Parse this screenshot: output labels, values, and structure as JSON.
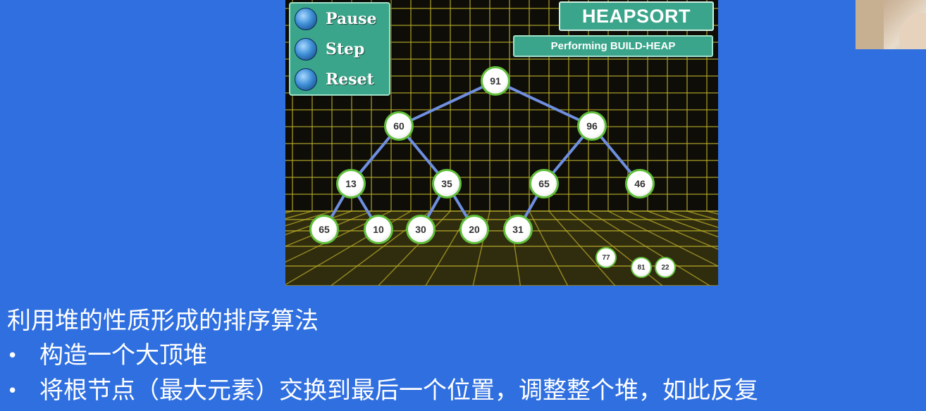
{
  "controls": {
    "pause_label": "Pause",
    "step_label": "Step",
    "reset_label": "Reset"
  },
  "title": "HEAPSORT",
  "status": "Performing BUILD-HEAP",
  "heap_nodes": [
    "91",
    "60",
    "96",
    "13",
    "35",
    "65",
    "46",
    "65",
    "10",
    "30",
    "20",
    "31"
  ],
  "sorted_nodes": [
    "77",
    "81",
    "22"
  ],
  "text": {
    "heading": "利用堆的性质形成的排序算法",
    "bullet_symbol": "•",
    "bullets": [
      "构造一个大顶堆",
      "将根节点（最大元素）交换到最后一个位置，调整整个堆，如此反复"
    ]
  },
  "colors": {
    "slide_background": "#2f6fe0",
    "panel": "#3aa58a",
    "grid": "#b9ad2a",
    "node_border": "#5fbf3a",
    "edge": "#6f8fe0"
  }
}
